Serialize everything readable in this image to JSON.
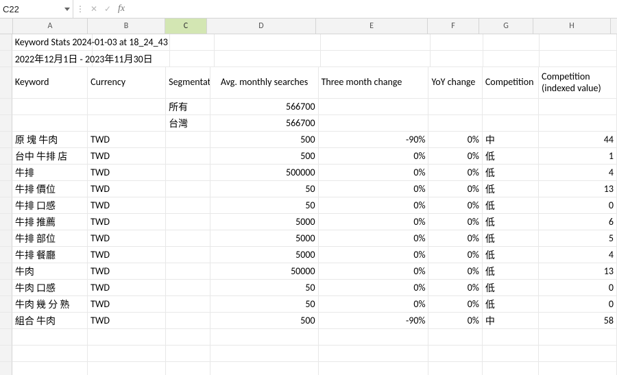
{
  "formula_bar": {
    "cell_ref": "C22",
    "fx_label": "fx",
    "formula_value": ""
  },
  "columns": [
    "A",
    "B",
    "C",
    "D",
    "E",
    "F",
    "G",
    "H"
  ],
  "title_rows": {
    "r1": "Keyword Stats 2024-01-03 at 18_24_43",
    "r2": "2022年12月1日 - 2023年11月30日"
  },
  "headers": {
    "keyword": "Keyword",
    "currency": "Currency",
    "segmentation": "Segmentation",
    "avg_searches": "Avg. monthly searches",
    "three_month": "Three month change",
    "yoy": "YoY change",
    "competition": "Competition",
    "competition_idx": "Competition (indexed value)"
  },
  "segmentation_rows": [
    {
      "segmentation": "所有",
      "avg_searches": "566700"
    },
    {
      "segmentation": "台灣",
      "avg_searches": "566700"
    }
  ],
  "data_rows": [
    {
      "keyword": "原 塊 牛肉",
      "currency": "TWD",
      "avg_searches": "500",
      "three_month": "-90%",
      "yoy": "0%",
      "competition": "中",
      "competition_idx": "44"
    },
    {
      "keyword": "台中 牛排 店",
      "currency": "TWD",
      "avg_searches": "500",
      "three_month": "0%",
      "yoy": "0%",
      "competition": "低",
      "competition_idx": "1"
    },
    {
      "keyword": "牛排",
      "currency": "TWD",
      "avg_searches": "500000",
      "three_month": "0%",
      "yoy": "0%",
      "competition": "低",
      "competition_idx": "4"
    },
    {
      "keyword": "牛排 價位",
      "currency": "TWD",
      "avg_searches": "50",
      "three_month": "0%",
      "yoy": "0%",
      "competition": "低",
      "competition_idx": "13"
    },
    {
      "keyword": "牛排 口感",
      "currency": "TWD",
      "avg_searches": "50",
      "three_month": "0%",
      "yoy": "0%",
      "competition": "低",
      "competition_idx": "0"
    },
    {
      "keyword": "牛排 推薦",
      "currency": "TWD",
      "avg_searches": "5000",
      "three_month": "0%",
      "yoy": "0%",
      "competition": "低",
      "competition_idx": "6"
    },
    {
      "keyword": "牛排 部位",
      "currency": "TWD",
      "avg_searches": "5000",
      "three_month": "0%",
      "yoy": "0%",
      "competition": "低",
      "competition_idx": "5"
    },
    {
      "keyword": "牛排 餐廳",
      "currency": "TWD",
      "avg_searches": "5000",
      "three_month": "0%",
      "yoy": "0%",
      "competition": "低",
      "competition_idx": "4"
    },
    {
      "keyword": "牛肉",
      "currency": "TWD",
      "avg_searches": "50000",
      "three_month": "0%",
      "yoy": "0%",
      "competition": "低",
      "competition_idx": "13"
    },
    {
      "keyword": "牛肉 口感",
      "currency": "TWD",
      "avg_searches": "50",
      "three_month": "0%",
      "yoy": "0%",
      "competition": "低",
      "competition_idx": "0"
    },
    {
      "keyword": "牛肉 幾 分 熟",
      "currency": "TWD",
      "avg_searches": "50",
      "three_month": "0%",
      "yoy": "0%",
      "competition": "低",
      "competition_idx": "0"
    },
    {
      "keyword": "組合 牛肉",
      "currency": "TWD",
      "avg_searches": "500",
      "three_month": "-90%",
      "yoy": "0%",
      "competition": "中",
      "competition_idx": "58"
    }
  ],
  "active_cell": "C22"
}
